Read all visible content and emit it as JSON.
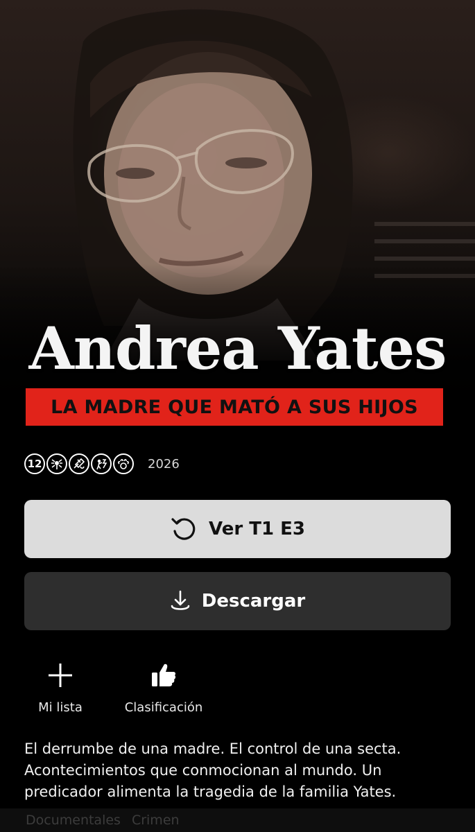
{
  "hero": {
    "title": "Andrea Yates",
    "subtitle": "LA MADRE QUE MATÓ A SUS HIJOS"
  },
  "rating": {
    "age_badge": "12",
    "content_icons": [
      "fear-icon",
      "violence-icon",
      "mental-health-icon",
      "drugs-icon"
    ],
    "year": "2026"
  },
  "buttons": {
    "play_label": "Ver T1 E3",
    "download_label": "Descargar"
  },
  "actions": {
    "my_list_label": "Mi lista",
    "rate_label": "Clasificación"
  },
  "description": "El derrumbe de una madre. El control de una secta. Acontecimientos que conmocionan al mundo. Un predicador alimenta la tragedia de la familia Yates.",
  "genres": [
    "Documentales",
    "Crimen"
  ],
  "colors": {
    "accent_red": "#e1231a",
    "play_button_bg": "#dcdcdc",
    "secondary_button_bg": "#2e2e2e",
    "background": "#000000"
  }
}
